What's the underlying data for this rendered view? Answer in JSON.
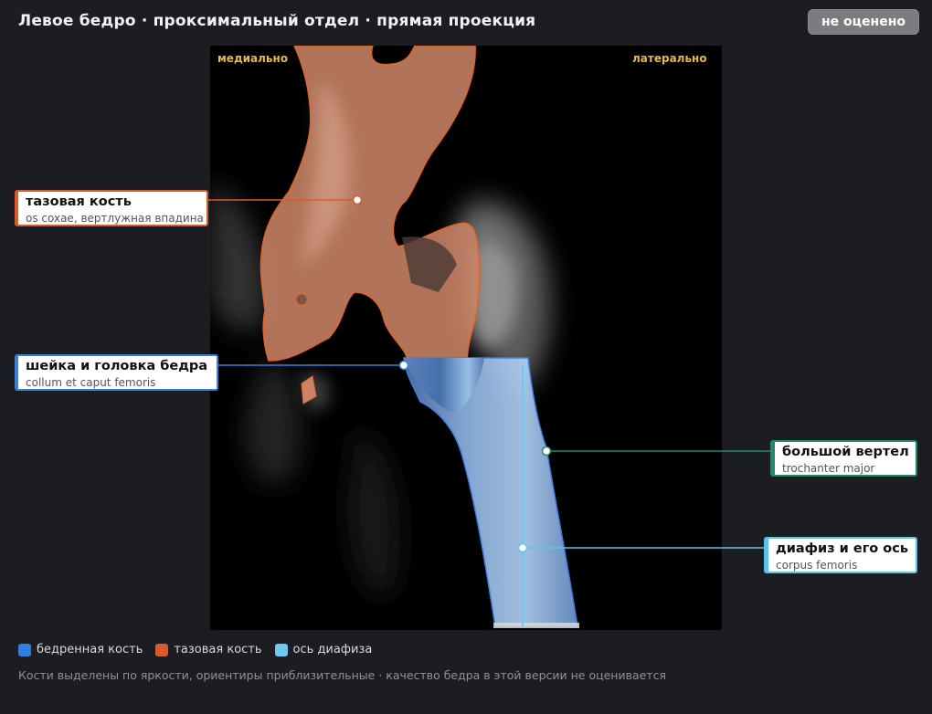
{
  "header": {
    "title": "Левое бедро · проксимальный отдел · прямая проекция",
    "status_badge": "не оценено"
  },
  "image": {
    "orientation_left": "медиально",
    "orientation_right": "латерально"
  },
  "callouts": [
    {
      "id": "pelvis",
      "name": "тазовая кость",
      "latin": "os coxae, вертлужная впадина",
      "color": "#d95a2b"
    },
    {
      "id": "neck",
      "name": "шейка и головка бедра",
      "latin": "collum et caput femoris",
      "color": "#3b7fd9"
    },
    {
      "id": "trochanter",
      "name": "большой вертел",
      "latin": "trochanter major",
      "color": "#1f8a66"
    },
    {
      "id": "shaft",
      "name": "диафиз и его ось",
      "latin": "corpus femoris",
      "color": "#5cc3e8"
    }
  ],
  "legend": [
    {
      "label": "бедренная кость",
      "color": "#2f7fdc"
    },
    {
      "label": "тазовая кость",
      "color": "#d95a2b"
    },
    {
      "label": "ось диафиза",
      "color": "#6ccaf0"
    }
  ],
  "footnote": "Кости выделены по яркости, ориентиры приблизительные · качество бедра в этой версии не оценивается"
}
